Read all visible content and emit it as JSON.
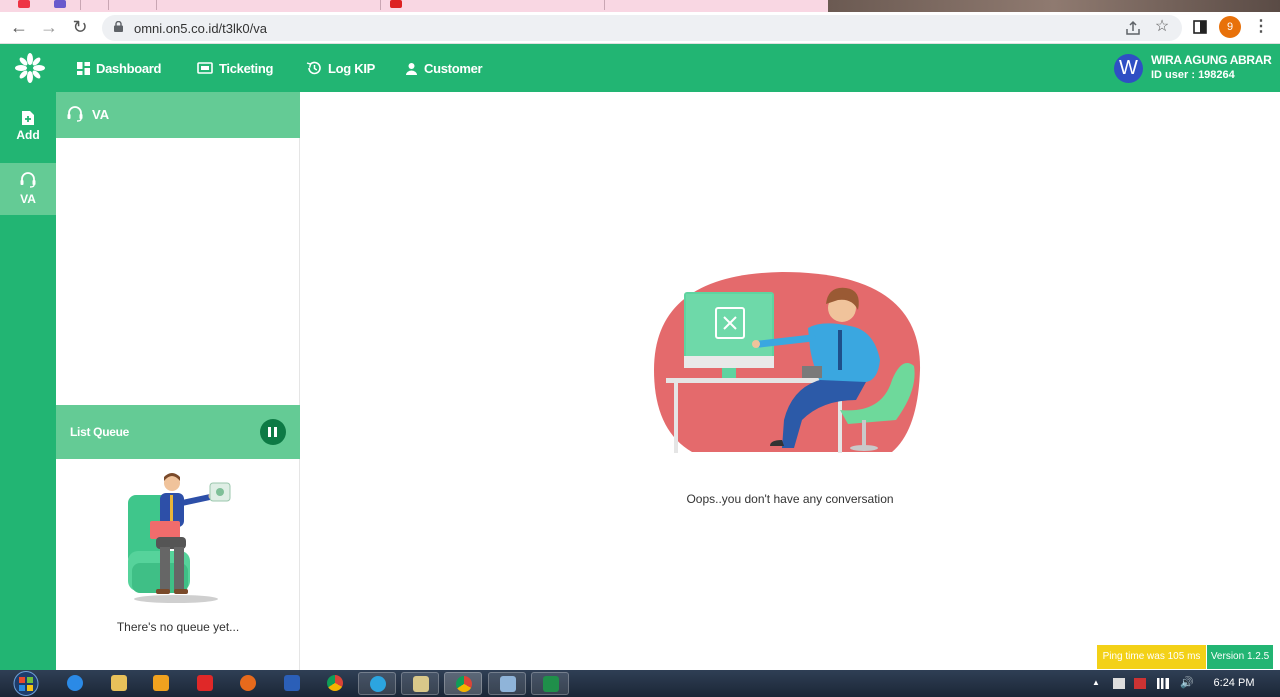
{
  "browser": {
    "url": "omni.on5.co.id/t3lk0/va",
    "profile_initial": "9"
  },
  "nav": {
    "items": [
      {
        "label": "Dashboard"
      },
      {
        "label": "Ticketing"
      },
      {
        "label": "Log KIP"
      },
      {
        "label": "Customer"
      }
    ]
  },
  "user": {
    "initial": "W",
    "name": "WIRA AGUNG ABRAR",
    "id_text": "ID user : 198264"
  },
  "rail": {
    "items": [
      {
        "label": "Add"
      },
      {
        "label": "VA"
      }
    ]
  },
  "panel": {
    "title": "VA"
  },
  "queue": {
    "title": "List Queue",
    "empty_text": "There's no queue yet..."
  },
  "main": {
    "empty_text": "Oops..you don't have any conversation"
  },
  "footer": {
    "ping": "Ping time was 105 ms",
    "version": "Version 1.2.5"
  },
  "taskbar": {
    "time": "6:24 PM"
  },
  "colors": {
    "brand_green": "#22b573",
    "light_green": "#64cb95",
    "ping_yellow": "#f3d117"
  }
}
